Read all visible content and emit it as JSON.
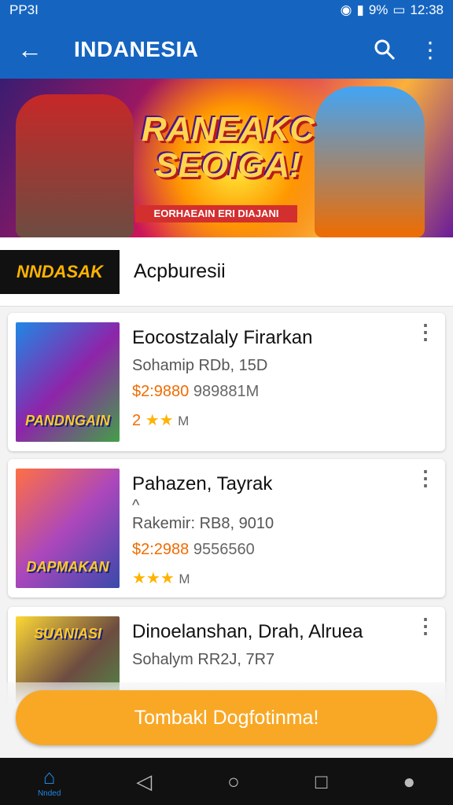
{
  "status_bar": {
    "left_text": "PP3I",
    "battery": "9%",
    "time": "12:38"
  },
  "app_bar": {
    "title": "INDANESIA"
  },
  "banner": {
    "headline_line1": "RANEAKC",
    "headline_line2": "SEOIGA!",
    "tagline": "EORHAEAIN ERI DIAJANI"
  },
  "section": {
    "logo_text": "NNDASAK",
    "title": "Acpburesii"
  },
  "items": [
    {
      "thumb_caption": "PANDNGAIN",
      "name": "Eocostzalaly Firarkan",
      "subtitle": "Sohamip RDb, 15D",
      "price": "$2:9880",
      "count": "989881M",
      "rating_num": "2",
      "rating_suffix": "M",
      "colors": [
        "#1e88e5",
        "#8e24aa",
        "#43a047"
      ]
    },
    {
      "thumb_caption": "DAPMAKAN",
      "name": "Pahazen, Tayrak",
      "subtitle_line0": "^",
      "subtitle": "Rakemir: RB8, 9010",
      "price": "$2:2988",
      "count": "9556560",
      "rating_num": "",
      "rating_suffix": "M",
      "colors": [
        "#ff7043",
        "#ab47bc",
        "#3949ab"
      ]
    },
    {
      "thumb_caption": "SUANIASI",
      "name": "Dinoelanshan, Drah, Alruea",
      "subtitle": "Sohalym RR2J, 7R7",
      "price": "",
      "count": "",
      "rating_num": "",
      "rating_suffix": "",
      "colors": [
        "#fdd835",
        "#6d4c41",
        "#43a047"
      ]
    }
  ],
  "cta": {
    "label": "Tombakl  Dogfotinma!"
  },
  "nav": {
    "home_label": "Nnded"
  }
}
